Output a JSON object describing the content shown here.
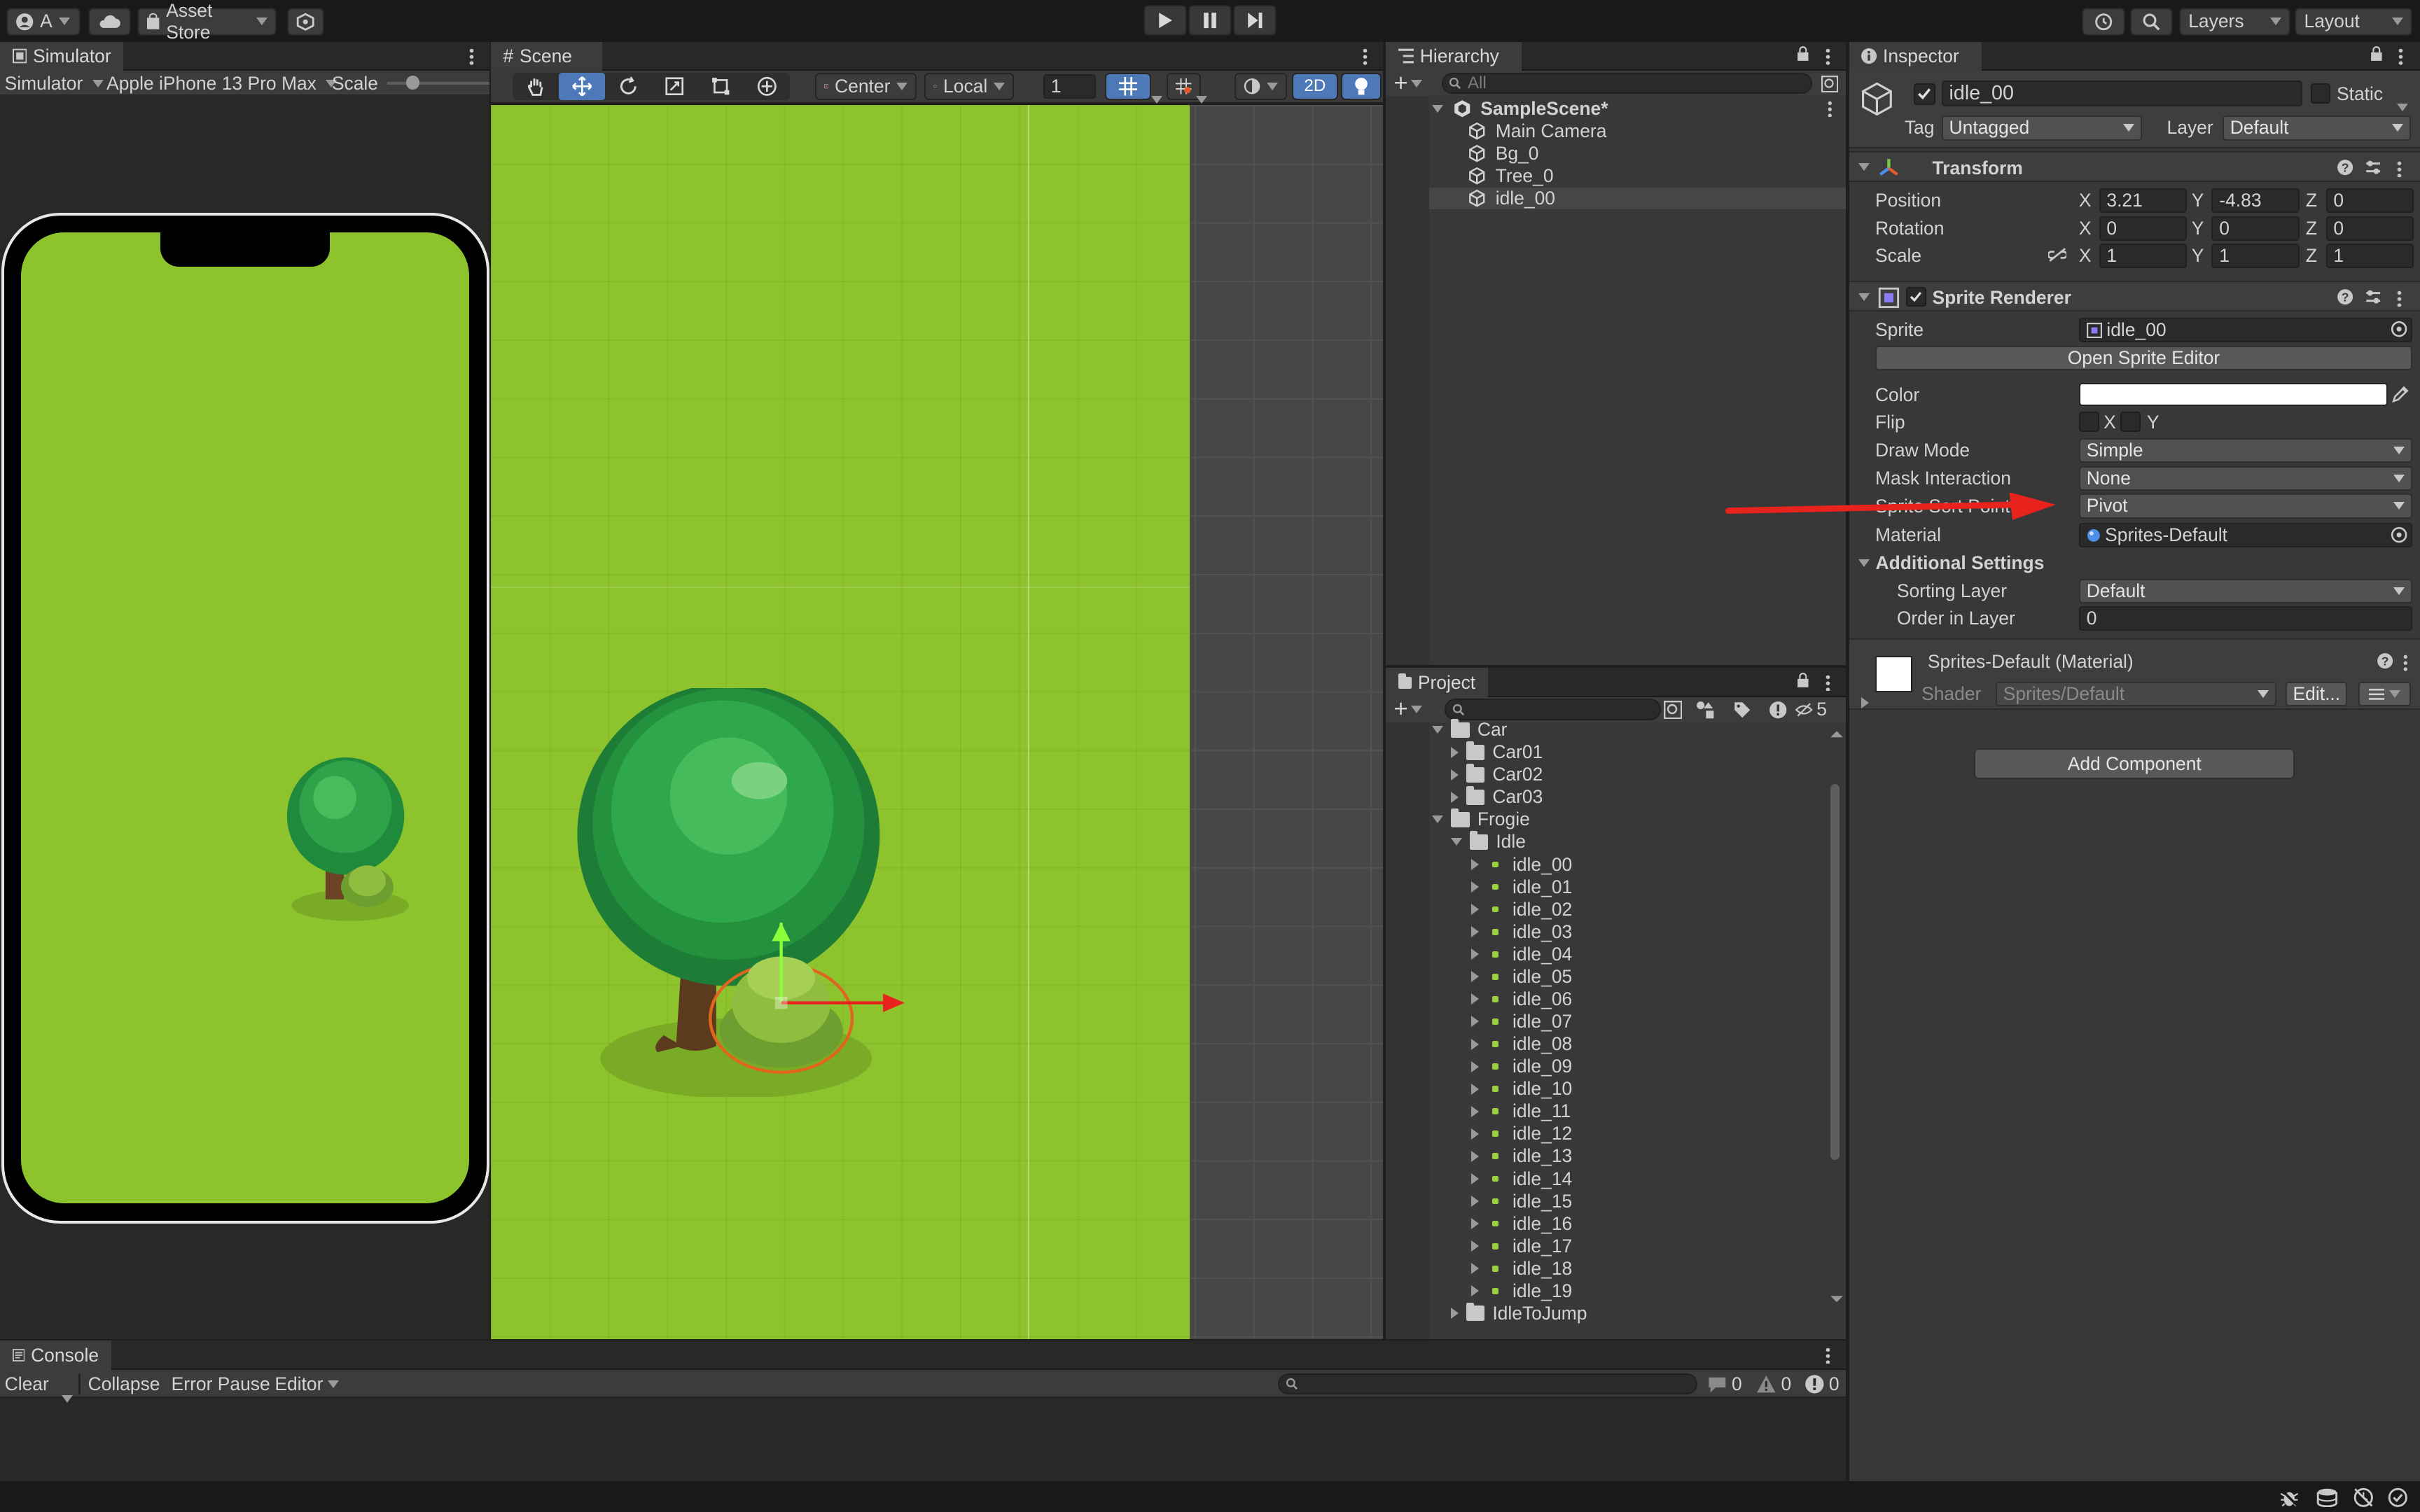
{
  "toolbar": {
    "account_label": "A",
    "asset_store_label": "Asset Store",
    "layers_label": "Layers",
    "layout_label": "Layout"
  },
  "simulator": {
    "tab_label": "Simulator",
    "mode_label": "Simulator",
    "device_label": "Apple iPhone 13 Pro Max",
    "scale_label": "Scale"
  },
  "scene": {
    "tab_label": "Scene",
    "pivot_label": "Center",
    "space_label": "Local",
    "grid_value": "1",
    "mode_2d_label": "2D"
  },
  "hierarchy": {
    "tab_label": "Hierarchy",
    "search_placeholder": "All",
    "scene_name": "SampleScene*",
    "items": [
      "Main Camera",
      "Bg_0",
      "Tree_0",
      "idle_00"
    ]
  },
  "project": {
    "tab_label": "Project",
    "hidden_count": "5",
    "tree": {
      "car_folder": "Car",
      "car_children": [
        "Car01",
        "Car02",
        "Car03"
      ],
      "frogie_folder": "Frogie",
      "idle_folder": "Idle",
      "idle_items": [
        "idle_00",
        "idle_01",
        "idle_02",
        "idle_03",
        "idle_04",
        "idle_05",
        "idle_06",
        "idle_07",
        "idle_08",
        "idle_09",
        "idle_10",
        "idle_11",
        "idle_12",
        "idle_13",
        "idle_14",
        "idle_15",
        "idle_16",
        "idle_17",
        "idle_18",
        "idle_19"
      ],
      "next_folder": "IdleToJump"
    }
  },
  "inspector": {
    "tab_label": "Inspector",
    "object_name": "idle_00",
    "static_label": "Static",
    "tag_label": "Tag",
    "tag_value": "Untagged",
    "layer_label": "Layer",
    "layer_value": "Default",
    "transform": {
      "title": "Transform",
      "position_label": "Position",
      "rotation_label": "Rotation",
      "scale_label": "Scale",
      "axis_x": "X",
      "axis_y": "Y",
      "axis_z": "Z",
      "position": [
        "3.21",
        "-4.83",
        "0"
      ],
      "rotation": [
        "0",
        "0",
        "0"
      ],
      "scale": [
        "1",
        "1",
        "1"
      ]
    },
    "sprite_renderer": {
      "title": "Sprite Renderer",
      "sprite_label": "Sprite",
      "sprite_value": "idle_00",
      "open_editor_label": "Open Sprite Editor",
      "color_label": "Color",
      "flip_label": "Flip",
      "flip_x": "X",
      "flip_y": "Y",
      "draw_mode_label": "Draw Mode",
      "draw_mode_value": "Simple",
      "mask_label": "Mask Interaction",
      "mask_value": "None",
      "sort_point_label": "Sprite Sort Point",
      "sort_point_value": "Pivot",
      "material_label": "Material",
      "material_value": "Sprites-Default",
      "additional_label": "Additional Settings",
      "sorting_layer_label": "Sorting Layer",
      "sorting_layer_value": "Default",
      "order_label": "Order in Layer",
      "order_value": "0"
    },
    "material": {
      "title": "Sprites-Default (Material)",
      "shader_label": "Shader",
      "shader_value": "Sprites/Default",
      "edit_label": "Edit..."
    },
    "add_component_label": "Add Component"
  },
  "console": {
    "tab_label": "Console",
    "clear_label": "Clear",
    "collapse_label": "Collapse",
    "error_pause_label": "Error Pause",
    "editor_label": "Editor",
    "log_count": "0",
    "warn_count": "0",
    "error_count": "0"
  },
  "colors": {
    "accent_blue": "#4d79b8",
    "scene_green": "#8dc32d",
    "annotation_red": "#e8221c"
  }
}
